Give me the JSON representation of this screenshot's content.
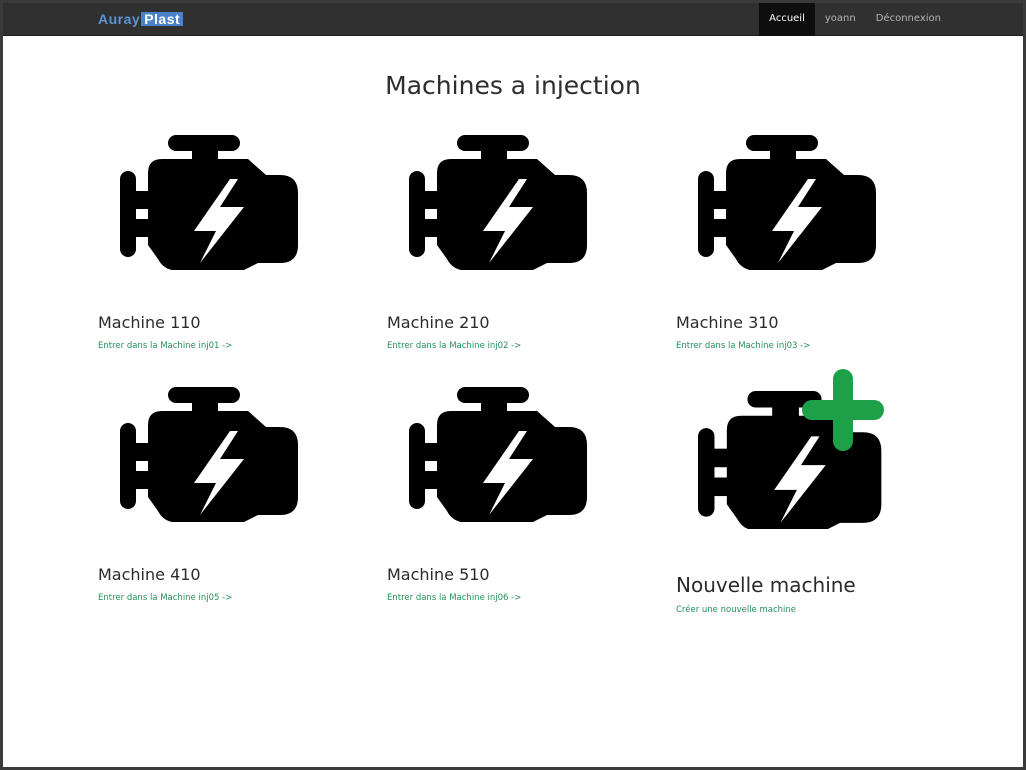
{
  "app": {
    "brand_part1": "Auray",
    "brand_part2": "Plast"
  },
  "nav": {
    "items": [
      {
        "label": "Accueil",
        "active": true
      },
      {
        "label": "yoann",
        "active": false
      },
      {
        "label": "Déconnexion",
        "active": false
      }
    ]
  },
  "page": {
    "title": "Machines a injection"
  },
  "machines": [
    {
      "name": "Machine 110",
      "link": "Entrer dans la Machine inj01 ->",
      "icon": "engine-icon"
    },
    {
      "name": "Machine 210",
      "link": "Entrer dans la Machine inj02 ->",
      "icon": "engine-icon"
    },
    {
      "name": "Machine 310",
      "link": "Entrer dans la Machine inj03 ->",
      "icon": "engine-icon"
    },
    {
      "name": "Machine 410",
      "link": "Entrer dans la Machine inj05 ->",
      "icon": "engine-icon"
    },
    {
      "name": "Machine 510",
      "link": "Entrer dans la Machine inj06 ->",
      "icon": "engine-icon"
    }
  ],
  "new_machine": {
    "name": "Nouvelle machine",
    "link": "Créer une nouvelle machine",
    "icon": "engine-add-icon"
  },
  "colors": {
    "navbar": "#303030",
    "active_nav": "#0e0e0e",
    "link": "#23905a",
    "plus": "#1ea049",
    "brand": "#4a82c8"
  }
}
